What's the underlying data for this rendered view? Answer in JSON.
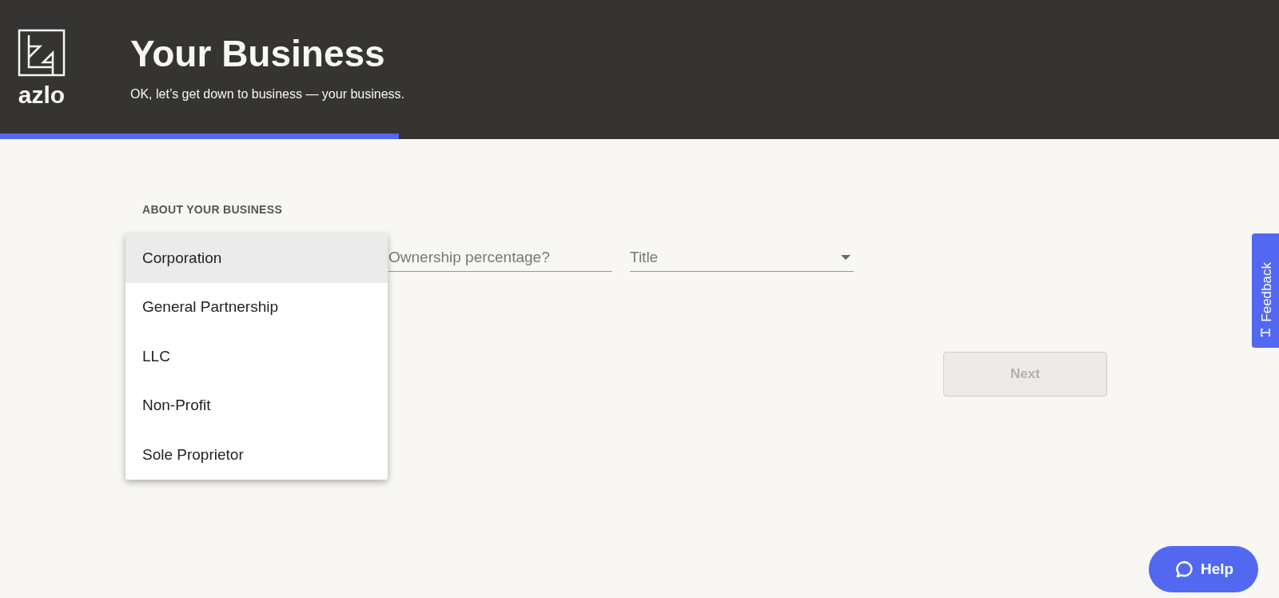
{
  "header": {
    "logo_text": "azlo",
    "title": "Your Business",
    "subtitle": "OK, let’s get down to business — your business.",
    "progress": {
      "level": 0.312
    }
  },
  "section": {
    "heading": "ABOUT YOUR BUSINESS"
  },
  "fields": [
    {
      "kind": "select",
      "open": true
    },
    {
      "kind": "text",
      "placeholder": "Ownership percentage?"
    },
    {
      "kind": "select",
      "placeholder": "Title",
      "open": false
    }
  ],
  "menu": [
    {
      "label": "Corporation",
      "selected": true
    },
    {
      "label": "General Partnership",
      "selected": false
    },
    {
      "label": "LLC",
      "selected": false
    },
    {
      "label": "Non-Profit",
      "selected": false
    },
    {
      "label": "Sole Proprietor",
      "selected": false
    }
  ],
  "next_button": {
    "label": "Next",
    "disabled": true
  },
  "feedback_tab": {
    "label": "Feedback"
  },
  "help_button": {
    "label": "Help"
  }
}
